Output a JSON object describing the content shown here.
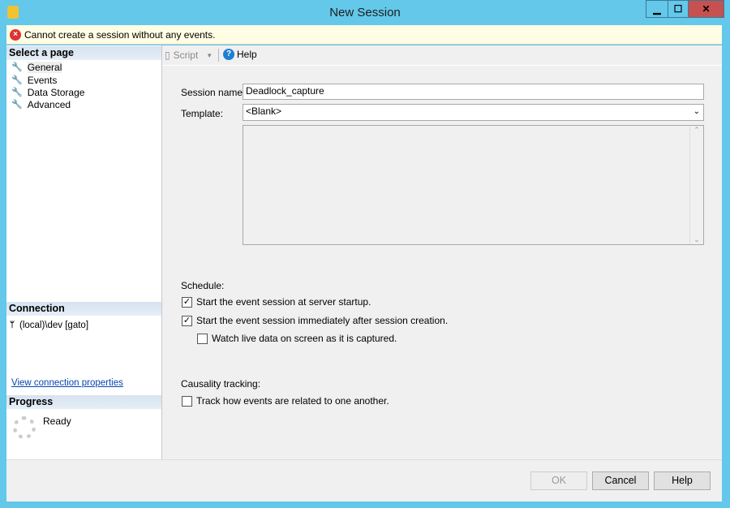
{
  "window": {
    "title": "New Session",
    "minimize": "▁",
    "maximize": "☐",
    "close": "✕"
  },
  "info_bar": {
    "message": "Cannot create a session without any events."
  },
  "sidebar": {
    "select_header": "Select a page",
    "pages": [
      {
        "label": "General"
      },
      {
        "label": "Events"
      },
      {
        "label": "Data Storage"
      },
      {
        "label": "Advanced"
      }
    ],
    "connection_header": "Connection",
    "connection": "(local)\\dev [gato]",
    "view_connection_link": "View connection properties",
    "progress_header": "Progress",
    "progress_status": "Ready"
  },
  "toolbar": {
    "script": "Script",
    "help": "Help"
  },
  "form": {
    "session_name_label": "Session name:",
    "session_name_value": "Deadlock_capture",
    "template_label": "Template:",
    "template_value": "<Blank>",
    "schedule_label": "Schedule:",
    "schedule_options": [
      {
        "label": "Start the event session at server startup.",
        "checked": true
      },
      {
        "label": "Start the event session immediately after session creation.",
        "checked": true
      },
      {
        "label": "Watch live data on screen as it is captured.",
        "checked": false
      }
    ],
    "causality_label": "Causality tracking:",
    "causality_option": {
      "label": "Track how events are related to one another.",
      "checked": false
    }
  },
  "buttons": {
    "ok": "OK",
    "cancel": "Cancel",
    "help": "Help"
  }
}
